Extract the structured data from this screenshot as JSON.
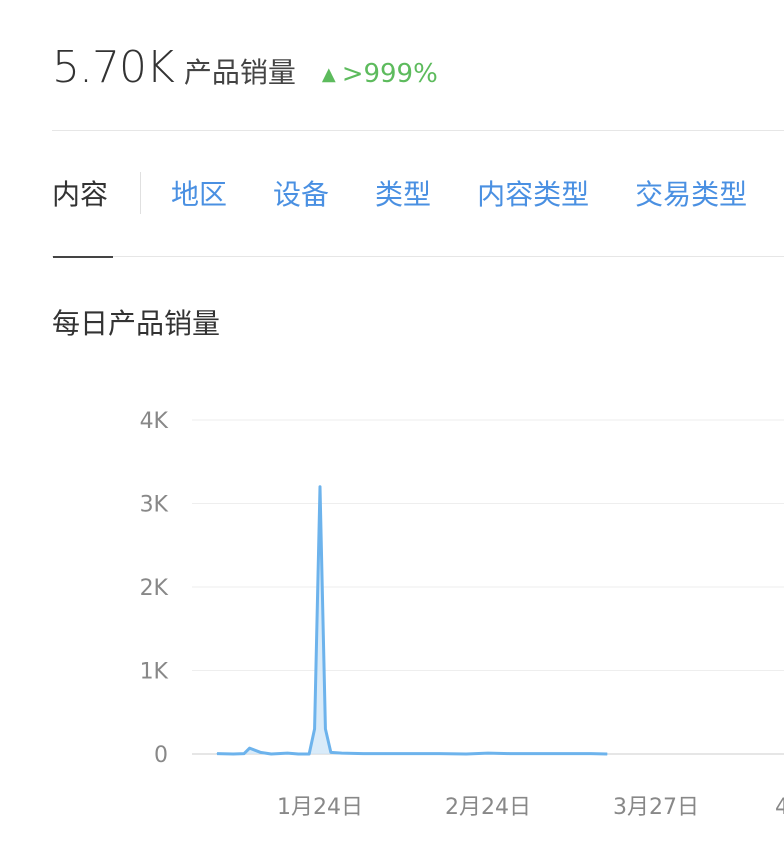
{
  "header": {
    "value": "5.70K",
    "label": "产品销量",
    "change": ">999%",
    "change_icon": "up-triangle-icon",
    "change_color": "#5dbb5d"
  },
  "tabs": [
    {
      "label": "内容",
      "active": true
    },
    {
      "label": "地区",
      "active": false
    },
    {
      "label": "设备",
      "active": false
    },
    {
      "label": "类型",
      "active": false
    },
    {
      "label": "内容类型",
      "active": false
    },
    {
      "label": "交易类型",
      "active": false
    }
  ],
  "section": {
    "title": "每日产品销量"
  },
  "colors": {
    "accent": "#4a90e2",
    "series": "#6db3ec",
    "fill": "#cfe6f8"
  },
  "chart_data": {
    "type": "area",
    "x": [
      "1月5日",
      "1月8日",
      "1月10日",
      "1月11日",
      "1月13日",
      "1月15日",
      "1月18日",
      "1月20日",
      "1月22日",
      "1月23日",
      "1月24日",
      "1月25日",
      "1月26日",
      "1月28日",
      "2月1日",
      "2月5日",
      "2月10日",
      "2月15日",
      "2月20日",
      "2月24日",
      "2月28日",
      "3月5日",
      "3月10日",
      "3月15日",
      "3月18日"
    ],
    "values": [
      5,
      0,
      5,
      70,
      20,
      0,
      10,
      0,
      0,
      300,
      3200,
      300,
      20,
      10,
      5,
      5,
      5,
      5,
      0,
      10,
      5,
      5,
      5,
      5,
      0
    ],
    "ylim": [
      0,
      4000
    ],
    "y_ticks": [
      "0",
      "1K",
      "2K",
      "3K",
      "4K"
    ],
    "x_ticks": [
      "1月24日",
      "2月24日",
      "3月27日",
      "4"
    ],
    "grid": true,
    "title": "",
    "xlabel": "",
    "ylabel": ""
  }
}
